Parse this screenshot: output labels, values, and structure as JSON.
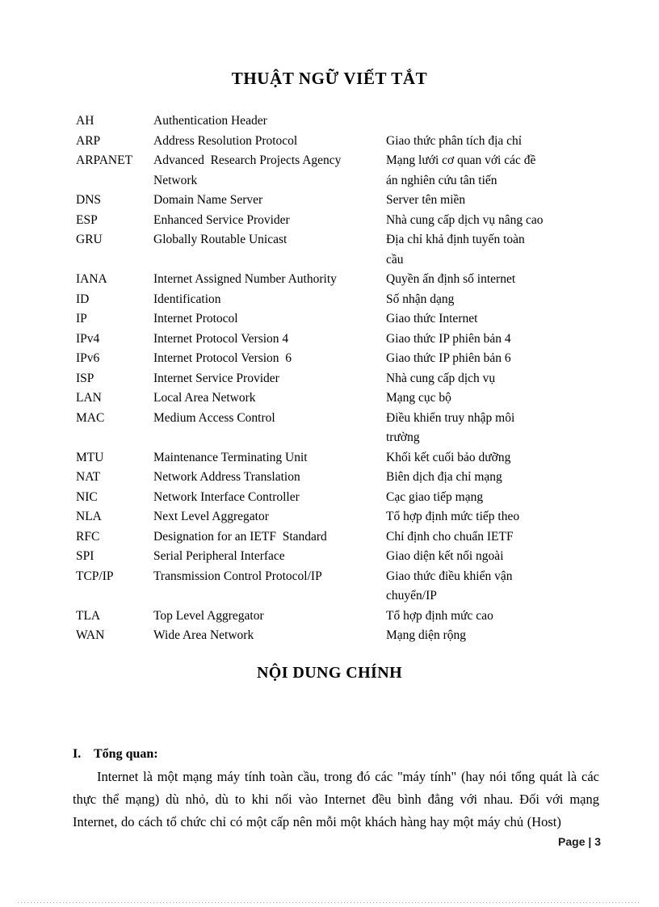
{
  "document": {
    "title": "THUẬT NGỮ VIẾT TẮT",
    "section_title": "NỘI DUNG CHÍNH",
    "footer": "Page | 3"
  },
  "abbreviations": [
    {
      "abbr": "AH",
      "full": "Authentication Header",
      "vi": "",
      "full_cont": "",
      "vi_cont": ""
    },
    {
      "abbr": "ARP",
      "full": "Address Resolution Protocol",
      "vi": "Giao thức phân tích địa chỉ",
      "full_cont": "",
      "vi_cont": ""
    },
    {
      "abbr": "ARPANET",
      "full": "Advanced  Research Projects Agency",
      "vi": "Mạng lưới cơ quan với các đề",
      "full_cont": "Network",
      "vi_cont": "án nghiên cứu tân tiến"
    },
    {
      "abbr": "DNS",
      "full": "Domain Name Server",
      "vi": "Server tên miền",
      "full_cont": "",
      "vi_cont": ""
    },
    {
      "abbr": "ESP",
      "full": "Enhanced Service Provider",
      "vi": "Nhà cung cấp dịch vụ nâng cao",
      "full_cont": "",
      "vi_cont": ""
    },
    {
      "abbr": "GRU",
      "full": "Globally Routable Unicast",
      "vi": "Địa chỉ khả định tuyến toàn",
      "full_cont": "",
      "vi_cont": "cầu"
    },
    {
      "abbr": "IANA",
      "full": "Internet Assigned Number Authority",
      "vi": "Quyền ấn định số internet",
      "full_cont": "",
      "vi_cont": ""
    },
    {
      "abbr": "ID",
      "full": "Identification",
      "vi": "Số nhận dạng",
      "full_cont": "",
      "vi_cont": ""
    },
    {
      "abbr": "IP",
      "full": "Internet Protocol",
      "vi": "Giao thức Internet",
      "full_cont": "",
      "vi_cont": ""
    },
    {
      "abbr": "IPv4",
      "full": "Internet Protocol Version 4",
      "vi": "Giao thức IP phiên bản 4",
      "full_cont": "",
      "vi_cont": ""
    },
    {
      "abbr": "IPv6",
      "full": "Internet Protocol Version  6",
      "vi": "Giao thức IP phiên bản 6",
      "full_cont": "",
      "vi_cont": ""
    },
    {
      "abbr": "ISP",
      "full": "Internet Service Provider",
      "vi": "Nhà cung cấp dịch vụ",
      "full_cont": "",
      "vi_cont": ""
    },
    {
      "abbr": "LAN",
      "full": "Local Area Network",
      "vi": "Mạng cục bộ",
      "full_cont": "",
      "vi_cont": ""
    },
    {
      "abbr": "MAC",
      "full": "Medium Access Control",
      "vi": "Điều khiển truy nhập môi",
      "full_cont": "",
      "vi_cont": "trường"
    },
    {
      "abbr": "MTU",
      "full": "Maintenance Terminating Unit",
      "vi": "Khối kết cuối bảo dưỡng",
      "full_cont": "",
      "vi_cont": ""
    },
    {
      "abbr": "NAT",
      "full": "Network Address Translation",
      "vi": "Biên dịch địa chỉ mạng",
      "full_cont": "",
      "vi_cont": ""
    },
    {
      "abbr": "NIC",
      "full": "Network Interface Controller",
      "vi": "Cạc giao tiếp mạng",
      "full_cont": "",
      "vi_cont": ""
    },
    {
      "abbr": "NLA",
      "full": "Next Level Aggregator",
      "vi": "Tổ hợp định mức tiếp theo",
      "full_cont": "",
      "vi_cont": ""
    },
    {
      "abbr": "RFC",
      "full": "Designation for an IETF  Standard",
      "vi": "Chỉ định cho chuẩn IETF",
      "full_cont": "",
      "vi_cont": ""
    },
    {
      "abbr": "SPI",
      "full": "Serial Peripheral Interface",
      "vi": "Giao diện kết nối ngoài",
      "full_cont": "",
      "vi_cont": ""
    },
    {
      "abbr": "TCP/IP",
      "full": "Transmission Control Protocol/IP",
      "vi": "Giao thức điều khiển vận",
      "full_cont": "",
      "vi_cont": "chuyển/IP"
    },
    {
      "abbr": "TLA",
      "full": "Top Level Aggregator",
      "vi": "Tổ hợp định mức cao",
      "full_cont": "",
      "vi_cont": ""
    },
    {
      "abbr": "WAN",
      "full": "Wide Area Network",
      "vi": "Mạng diện rộng",
      "full_cont": "",
      "vi_cont": ""
    }
  ],
  "content": {
    "heading_number": "I.",
    "heading_text": "Tổng quan:",
    "paragraph": "Internet là một mạng máy tính toàn cầu, trong đó các \"máy  tính\" (hay nói tổng quát là các thực thể mạng) dù nhỏ, dù to khi nối vào Internet đều bình đẳng với nhau. Đối với mạng Internet, do cách tổ chức chỉ có một cấp nên mỗi một khách hàng hay một máy chủ (Host)"
  }
}
